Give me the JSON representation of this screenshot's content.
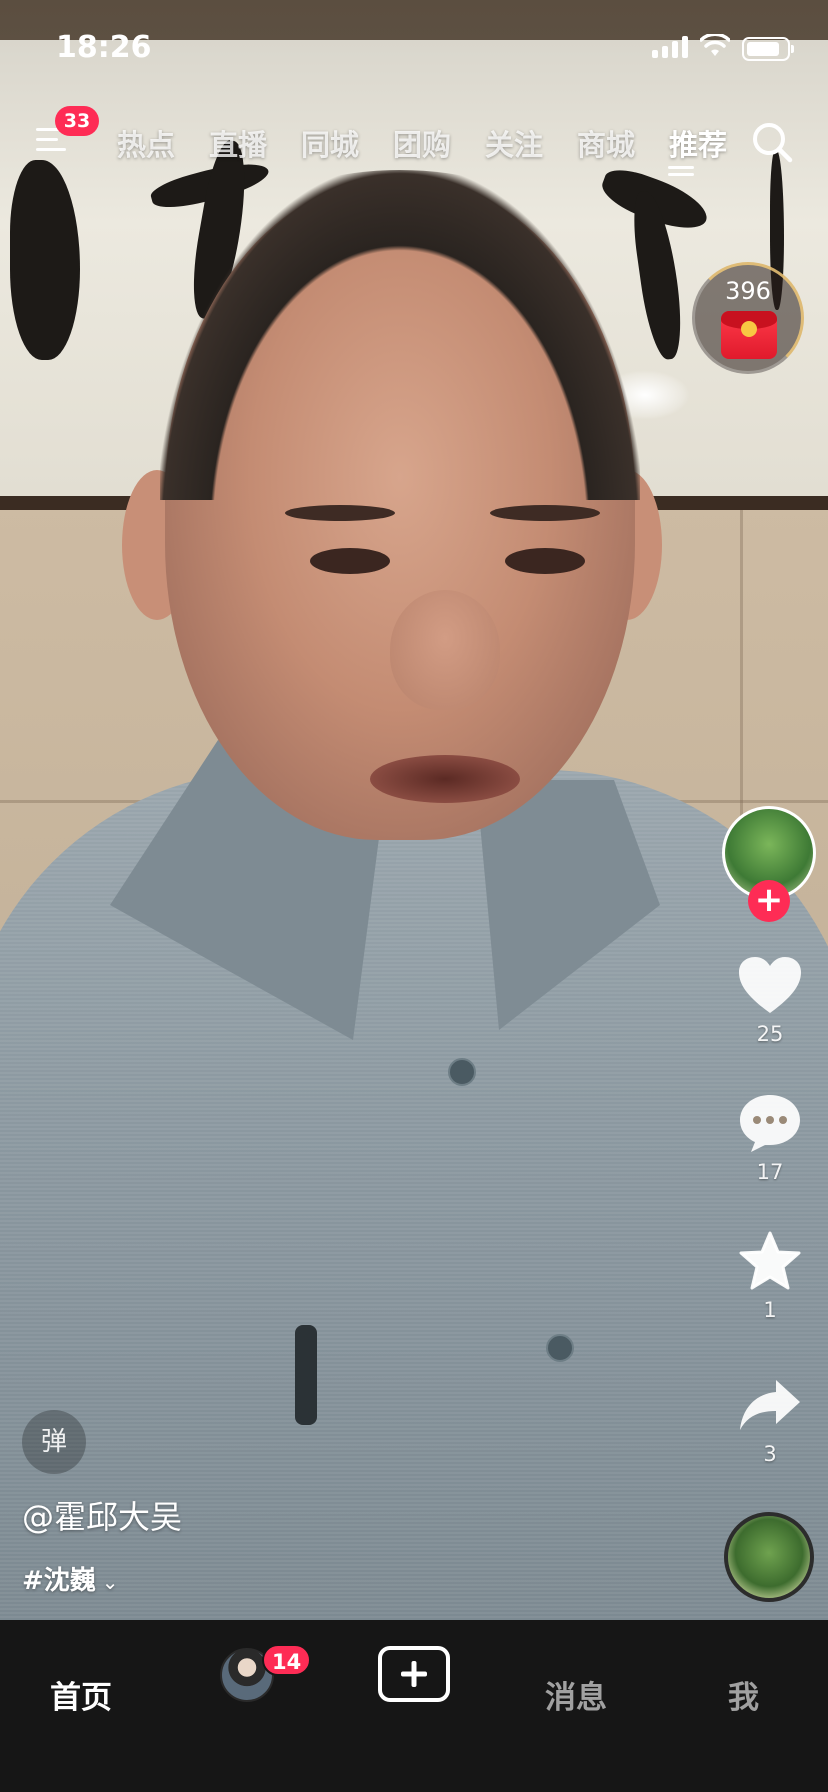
{
  "status_bar": {
    "time": "18:26"
  },
  "top_nav": {
    "menu_badge": "33",
    "tabs": [
      {
        "label": "热点",
        "active": false
      },
      {
        "label": "直播",
        "active": false
      },
      {
        "label": "同城",
        "active": false
      },
      {
        "label": "团购",
        "active": false
      },
      {
        "label": "关注",
        "active": false
      },
      {
        "label": "商城",
        "active": false
      },
      {
        "label": "推荐",
        "active": true
      }
    ],
    "search_icon": "search-icon"
  },
  "red_packet": {
    "count": "396",
    "icon": "red-envelope-icon"
  },
  "right_rail": {
    "author_avatar": "author-avatar",
    "follow_icon": "plus-icon",
    "like": {
      "icon": "heart-icon",
      "count": "25"
    },
    "comment": {
      "icon": "comment-icon",
      "count": "17"
    },
    "favorite": {
      "icon": "star-icon",
      "count": "1"
    },
    "share": {
      "icon": "share-icon",
      "count": "3"
    },
    "music_disc": "music-disc"
  },
  "video_info": {
    "danmu_label": "弹",
    "author": "@霍邱大吴",
    "hashtag": "#沈巍"
  },
  "tab_bar": {
    "home": "首页",
    "friend_badge": "14",
    "create_icon": "plus-icon",
    "messages": "消息",
    "me": "我"
  },
  "colors": {
    "accent": "#fe2c55",
    "tab_bar_bg": "#161616"
  }
}
